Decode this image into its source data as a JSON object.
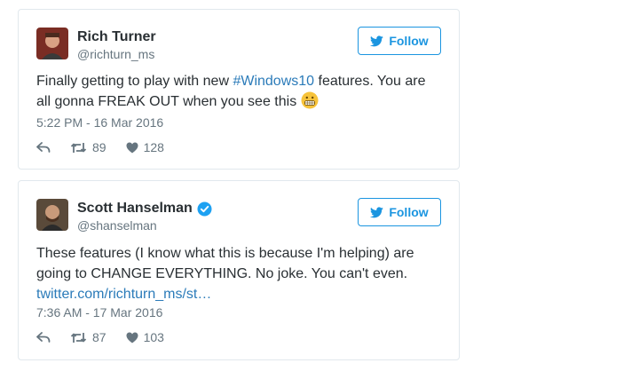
{
  "tweets": [
    {
      "name": "Rich Turner",
      "handle": "@richturn_ms",
      "follow_label": "Follow",
      "verified": false,
      "text_before": "Finally getting to play with new ",
      "hashtag": "#Windows10",
      "text_after": " features. You are all gonna FREAK OUT when you see this ",
      "timestamp": "5:22 PM - 16 Mar 2016",
      "retweets": "89",
      "likes": "128"
    },
    {
      "name": "Scott Hanselman",
      "handle": "@shanselman",
      "follow_label": "Follow",
      "verified": true,
      "text": "These features (I know what this is because I'm helping) are going to CHANGE EVERYTHING. No joke. You can't even.",
      "link": "twitter.com/richturn_ms/st…",
      "timestamp": "7:36 AM - 17 Mar 2016",
      "retweets": "87",
      "likes": "103"
    }
  ],
  "colors": {
    "brand_blue": "#1b95e0",
    "link": "#2b7bb9",
    "muted": "#66757f",
    "border": "#e1e8ed",
    "verified": "#1da1f2"
  }
}
